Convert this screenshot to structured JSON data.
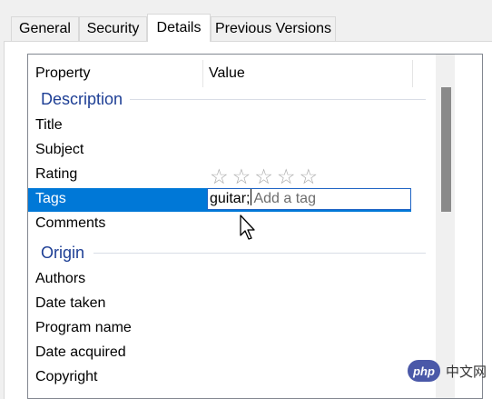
{
  "tabs": [
    {
      "label": "General"
    },
    {
      "label": "Security"
    },
    {
      "label": "Details"
    },
    {
      "label": "Previous Versions"
    }
  ],
  "columns": {
    "property": "Property",
    "value": "Value"
  },
  "groups": {
    "description": "Description",
    "origin": "Origin"
  },
  "description_rows": [
    {
      "label": "Title"
    },
    {
      "label": "Subject"
    },
    {
      "label": "Rating",
      "rating_stars": 0,
      "rating_max": 5
    },
    {
      "label": "Tags",
      "value": "guitar;",
      "placeholder": "Add a tag",
      "selected": true
    },
    {
      "label": "Comments"
    }
  ],
  "origin_rows": [
    {
      "label": "Authors"
    },
    {
      "label": "Date taken"
    },
    {
      "label": "Program name"
    },
    {
      "label": "Date acquired"
    },
    {
      "label": "Copyright"
    }
  ],
  "watermark": {
    "logo": "php",
    "text": "中文网"
  },
  "colors": {
    "selection": "#0078d7",
    "group_heading": "#1e3f95"
  }
}
